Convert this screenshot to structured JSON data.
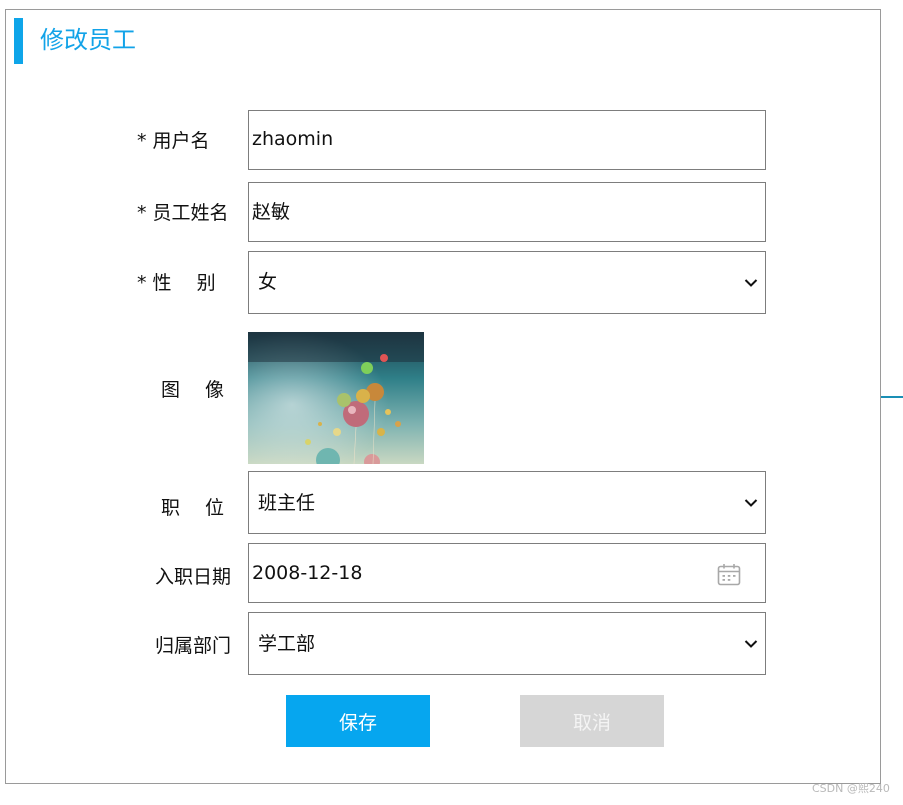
{
  "page": {
    "title": "修改员工",
    "accent_color": "#0ea5e9"
  },
  "form": {
    "username": {
      "label": "* 用户名",
      "value": "zhaomin"
    },
    "name": {
      "label": "* 员工姓名",
      "value": "赵敏"
    },
    "gender": {
      "label": "* 性　 别",
      "value": "女"
    },
    "avatar": {
      "label": "图　 像",
      "icon": "balloons-image"
    },
    "position": {
      "label": "职　 位",
      "value": "班主任"
    },
    "entry_date": {
      "label": "入职日期",
      "value": "2008-12-18",
      "icon": "calendar-icon"
    },
    "department": {
      "label": "归属部门",
      "value": "学工部"
    }
  },
  "buttons": {
    "save": "保存",
    "cancel": "取消"
  },
  "watermark": "CSDN @煕240"
}
